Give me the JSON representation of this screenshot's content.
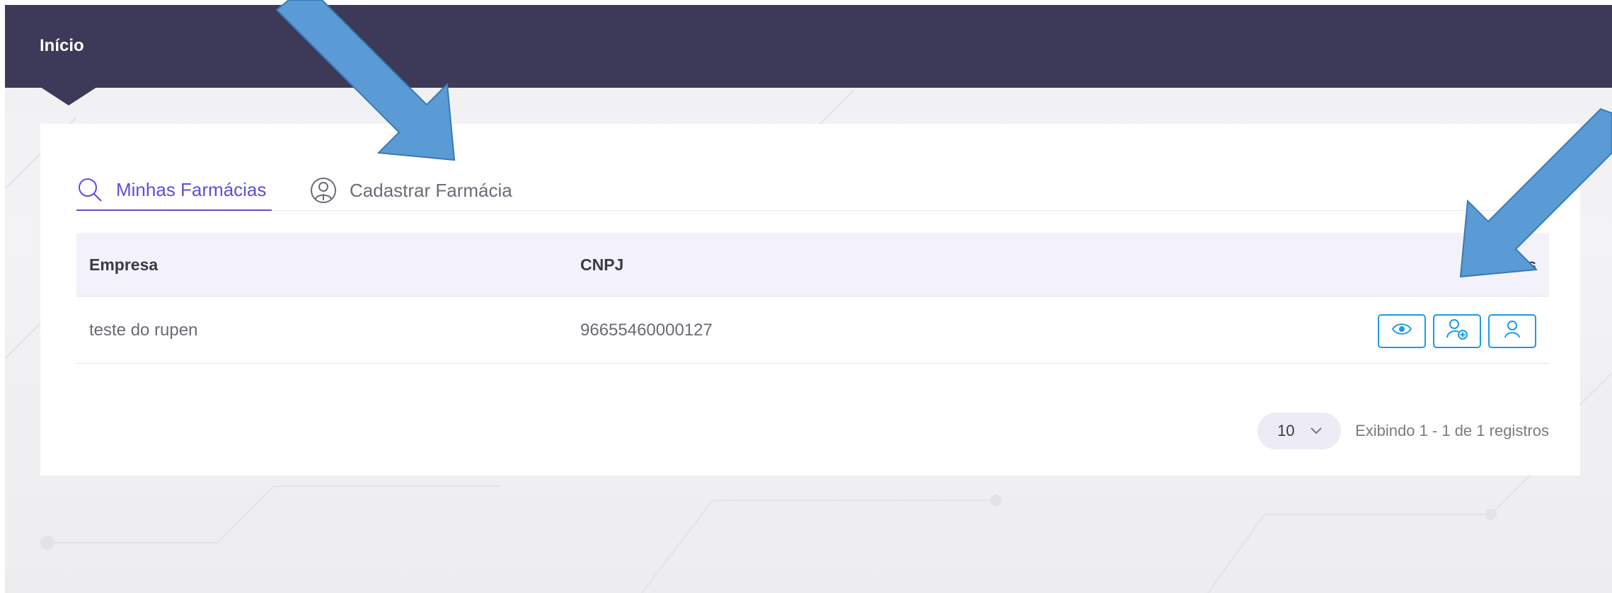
{
  "header": {
    "title": "Início"
  },
  "tabs": [
    {
      "label": "Minhas Farmácias",
      "icon": "search-icon",
      "active": true
    },
    {
      "label": "Cadastrar Farmácia",
      "icon": "pharmacist-icon",
      "active": false
    }
  ],
  "table": {
    "columns": [
      "Empresa",
      "CNPJ",
      "ões"
    ],
    "rows": [
      {
        "empresa": "teste do rupen",
        "cnpj": "96655460000127",
        "actions": [
          "eye-icon",
          "user-plus-icon",
          "user-icon"
        ]
      }
    ]
  },
  "pagination": {
    "page_size": "10",
    "info": "Exibindo 1 - 1 de 1 registros"
  },
  "colors": {
    "topbar": "#3d3958",
    "accent": "#5b50d6",
    "action_border": "#1e9be0",
    "annotation_arrow": "#5b9bd5"
  }
}
